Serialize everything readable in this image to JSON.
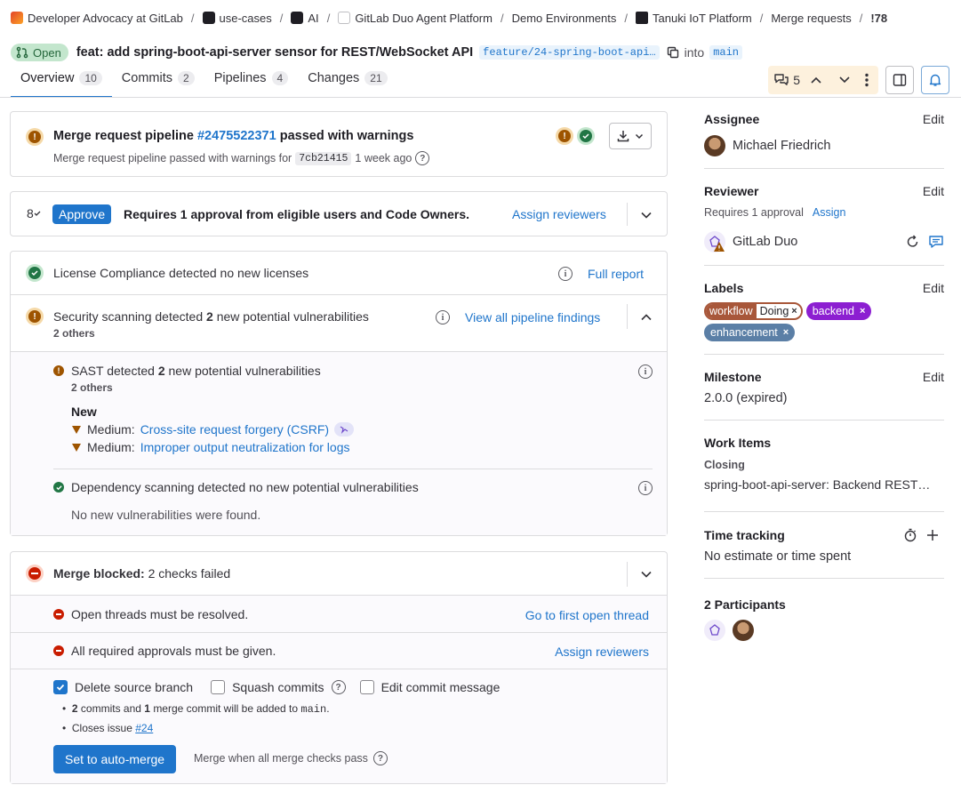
{
  "breadcrumb": {
    "items": [
      {
        "label": "Developer Advocacy at GitLab",
        "icon": "group-avatar-icon"
      },
      {
        "label": "use-cases",
        "icon": "group-avatar-icon"
      },
      {
        "label": "AI",
        "icon": "group-avatar-icon"
      },
      {
        "label": "GitLab Duo Agent Platform",
        "icon": "group-avatar-icon"
      },
      {
        "label": "Demo Environments",
        "icon": ""
      },
      {
        "label": "Tanuki IoT Platform",
        "icon": "project-avatar-icon"
      },
      {
        "label": "Merge requests",
        "icon": ""
      },
      {
        "label": "!78",
        "icon": ""
      }
    ]
  },
  "mr": {
    "status": "Open",
    "title": "feat: add spring-boot-api-server sensor for REST/WebSocket API",
    "source_branch": "feature/24-spring-boot-api…",
    "into": "into",
    "target_branch": "main"
  },
  "tabs": [
    {
      "label": "Overview",
      "count": "10"
    },
    {
      "label": "Commits",
      "count": "2"
    },
    {
      "label": "Pipelines",
      "count": "4"
    },
    {
      "label": "Changes",
      "count": "21"
    }
  ],
  "toolbar": {
    "comments_count": "5"
  },
  "pipeline": {
    "prefix": "Merge request pipeline",
    "id": "#2475522371",
    "suffix": "passed with warnings",
    "subtext": "Merge request pipeline passed with warnings for",
    "commit": "7cb21415",
    "time": "1 week ago"
  },
  "approval": {
    "approvers_icon_count": "8",
    "approve_label": "Approve",
    "text": "Requires 1 approval from eligible users and Code Owners.",
    "assign_reviewers": "Assign reviewers"
  },
  "license": {
    "text": "License Compliance detected no new licenses",
    "full_report": "Full report"
  },
  "security": {
    "text_prefix": "Security scanning detected",
    "count": "2",
    "text_suffix": "new potential vulnerabilities",
    "others": "2 others",
    "view_all": "View all pipeline findings",
    "sast": {
      "text_prefix": "SAST detected",
      "count": "2",
      "text_suffix": "new potential vulnerabilities",
      "others": "2 others",
      "new_heading": "New",
      "findings": [
        {
          "severity": "Medium:",
          "title": "Cross-site request forgery (CSRF)"
        },
        {
          "severity": "Medium:",
          "title": "Improper output neutralization for logs"
        }
      ]
    },
    "dependency": {
      "text": "Dependency scanning detected no new potential vulnerabilities",
      "none": "No new vulnerabilities were found."
    }
  },
  "merge": {
    "blocked_label": "Merge blocked:",
    "blocked_text": "2 checks failed",
    "checks": [
      {
        "text": "Open threads must be resolved.",
        "action": "Go to first open thread"
      },
      {
        "text": "All required approvals must be given.",
        "action": "Assign reviewers"
      }
    ],
    "options": [
      {
        "label": "Delete source branch",
        "checked": true
      },
      {
        "label": "Squash commits",
        "checked": false
      },
      {
        "label": "Edit commit message",
        "checked": false
      }
    ],
    "info_commits_n": "2",
    "info_commits_a": "commits and",
    "info_merge_n": "1",
    "info_commits_b": "merge commit will be added to",
    "info_branch": "main",
    "info_period": ".",
    "closes_text": "Closes issue",
    "closes_link": "#24",
    "button": "Set to auto-merge",
    "when_text": "Merge when all merge checks pass"
  },
  "sidebar": {
    "edit": "Edit",
    "assignee": {
      "title": "Assignee",
      "name": "Michael Friedrich"
    },
    "reviewer": {
      "title": "Reviewer",
      "requires": "Requires 1 approval",
      "assign": "Assign",
      "name": "GitLab Duo"
    },
    "labels": {
      "title": "Labels",
      "items": [
        {
          "scope": "workflow",
          "value": "Doing",
          "color": "#a8573a"
        },
        {
          "scope": "backend",
          "value": "",
          "color": "#8c1fd1"
        },
        {
          "scope": "enhancement",
          "value": "",
          "color": "#5b7fa6"
        }
      ]
    },
    "milestone": {
      "title": "Milestone",
      "value": "2.0.0 (expired)"
    },
    "work_items": {
      "title": "Work Items",
      "sub": "Closing",
      "item": "spring-boot-api-server: Backend REST…"
    },
    "time_tracking": {
      "title": "Time tracking",
      "value": "No estimate or time spent"
    },
    "participants": {
      "title": "2 Participants"
    }
  },
  "colors": {
    "accent": "#1f75cb",
    "success": "#217645",
    "warning": "#9e5400",
    "danger": "#c91c00"
  }
}
